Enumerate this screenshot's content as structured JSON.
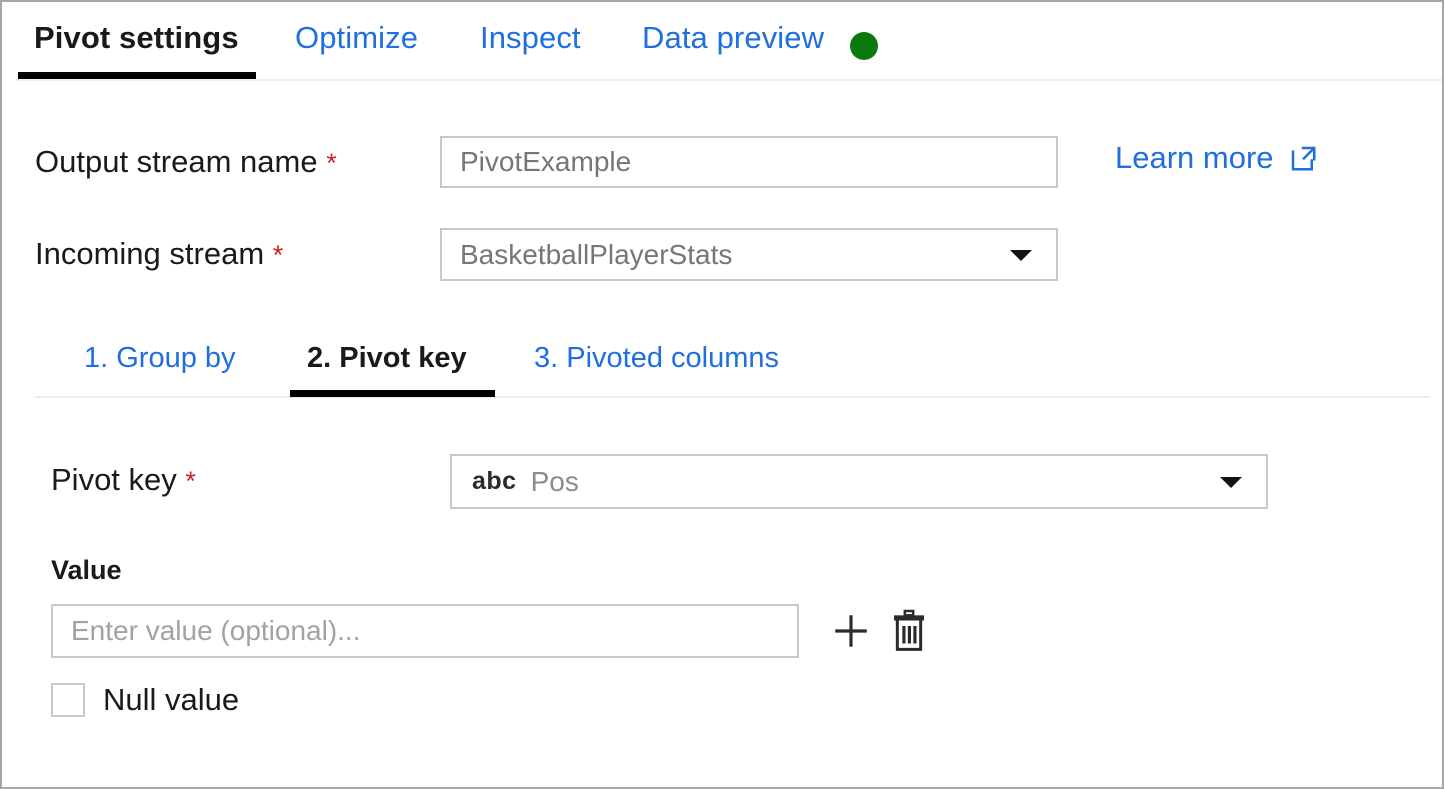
{
  "colors": {
    "link_blue": "#1f6fe0",
    "active_text": "#1a1a1a",
    "required_red": "#cc2222",
    "status_green": "#0a7a0a",
    "border_gray": "#c8c8c8",
    "placeholder_gray": "#a2a2a2"
  },
  "tabs": [
    {
      "label": "Pivot settings",
      "active": true
    },
    {
      "label": "Optimize",
      "active": false
    },
    {
      "label": "Inspect",
      "active": false
    },
    {
      "label": "Data preview",
      "active": false
    }
  ],
  "status_indicator": {
    "name": "data-preview-status-dot",
    "state": "ok"
  },
  "fields": {
    "output_stream": {
      "label": "Output stream name",
      "required_marker": "*",
      "value": "PivotExample"
    },
    "incoming_stream": {
      "label": "Incoming stream",
      "required_marker": "*",
      "value": "BasketballPlayerStats"
    }
  },
  "learn_more": {
    "label": "Learn more",
    "icon": "external-link-icon"
  },
  "subtabs": [
    {
      "label": "1. Group by",
      "active": false
    },
    {
      "label": "2. Pivot key",
      "active": true
    },
    {
      "label": "3. Pivoted columns",
      "active": false
    }
  ],
  "pivot_key": {
    "label": "Pivot key",
    "required_marker": "*",
    "type_badge": "abc",
    "value": "Pos"
  },
  "value_section": {
    "heading": "Value",
    "input_placeholder": "Enter value (optional)...",
    "input_value": "",
    "add_icon": "plus-icon",
    "delete_icon": "trash-icon",
    "null_checkbox": {
      "label": "Null value",
      "checked": false
    }
  }
}
